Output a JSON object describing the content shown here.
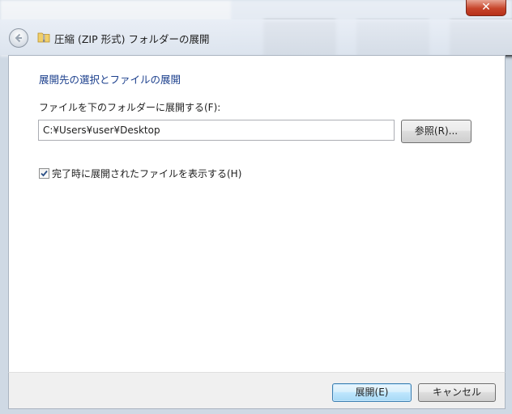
{
  "window": {
    "title": "圧縮 (ZIP 形式) フォルダーの展開",
    "close_glyph": "✕"
  },
  "icons": {
    "back": "back-arrow-icon",
    "folder": "zip-folder-icon",
    "check": "checkmark-icon"
  },
  "content": {
    "heading": "展開先の選択とファイルの展開",
    "path_label": "ファイルを下のフォルダーに展開する(F):",
    "path_value": "C:¥Users¥user¥Desktop",
    "browse_label": "参照(R)...",
    "show_files_label": "完了時に展開されたファイルを表示する(H)",
    "show_files_checked": true
  },
  "footer": {
    "extract_label": "展開(E)",
    "cancel_label": "キャンセル"
  },
  "colors": {
    "heading": "#1a3e8c",
    "default_button_border": "#3c7fb1",
    "close_button": "#c7452b"
  }
}
